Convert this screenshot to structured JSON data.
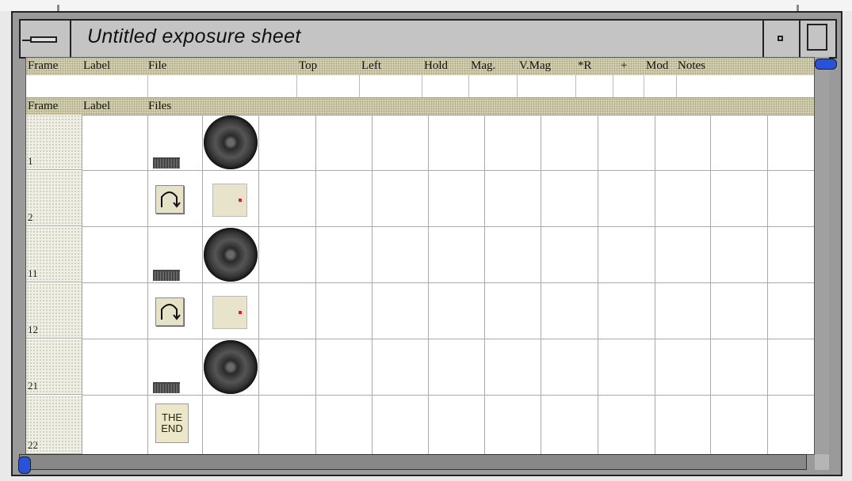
{
  "window": {
    "title": "Untitled exposure sheet"
  },
  "columns_row1": [
    "Frame",
    "Label",
    "File",
    "Top",
    "Left",
    "Hold",
    "Mag.",
    "V.Mag",
    "*R",
    "+",
    "Mod",
    "Notes"
  ],
  "columns_row2": [
    "Frame",
    "Label",
    "Files"
  ],
  "frames": [
    {
      "number": "1",
      "file_icon": "bar-icon",
      "second_icon": "disc-icon"
    },
    {
      "number": "2",
      "file_icon": "wave-icon",
      "second_icon": "dot-icon"
    },
    {
      "number": "11",
      "file_icon": "bar-icon",
      "second_icon": "disc-icon"
    },
    {
      "number": "12",
      "file_icon": "wave-icon",
      "second_icon": "dot-icon"
    },
    {
      "number": "21",
      "file_icon": "bar-icon",
      "second_icon": "disc-icon"
    },
    {
      "number": "22",
      "file_icon": "the-end-icon",
      "end_text_1": "THE",
      "end_text_2": "END"
    }
  ],
  "colors": {
    "header": "#d6d2b0",
    "scroll_thumb": "#2a52d6",
    "accent_dot": "#e02020"
  }
}
